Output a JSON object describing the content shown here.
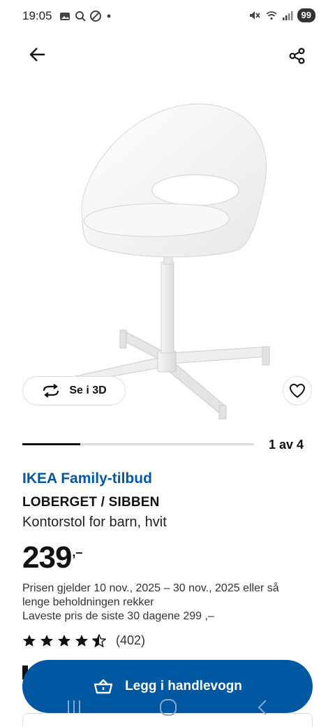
{
  "status_bar": {
    "time": "19:05",
    "battery": "99",
    "icons": [
      "photos-icon",
      "search-icon",
      "blocked-icon",
      "dot-icon",
      "mute-icon",
      "wifi-icon",
      "signal-icon"
    ]
  },
  "nav": {
    "back_icon": "arrow-left-icon",
    "share_icon": "share-icon"
  },
  "media": {
    "view_3d_label": "Se i 3D",
    "counter": "1 av 4",
    "progress_fraction": 0.25
  },
  "product": {
    "offer_label": "IKEA Family-tilbud",
    "name": "LOBERGET / SIBBEN",
    "description": "Kontorstol for barn, hvit",
    "price_main": "239",
    "price_suffix": ",–",
    "price_valid_line1": "Prisen gjelder 10 nov., 2025 – 30 nov., 2025 eller så",
    "price_valid_line2": "lenge beholdningen rekker",
    "lowest_price": "Laveste pris de siste 30 dagene  299 ,–",
    "rating": 4.5,
    "rating_count": "(402)"
  },
  "cta": {
    "add_to_cart_label": "Legg i handlevogn"
  },
  "colors": {
    "brand_blue": "#0058a3",
    "text": "#111111"
  }
}
